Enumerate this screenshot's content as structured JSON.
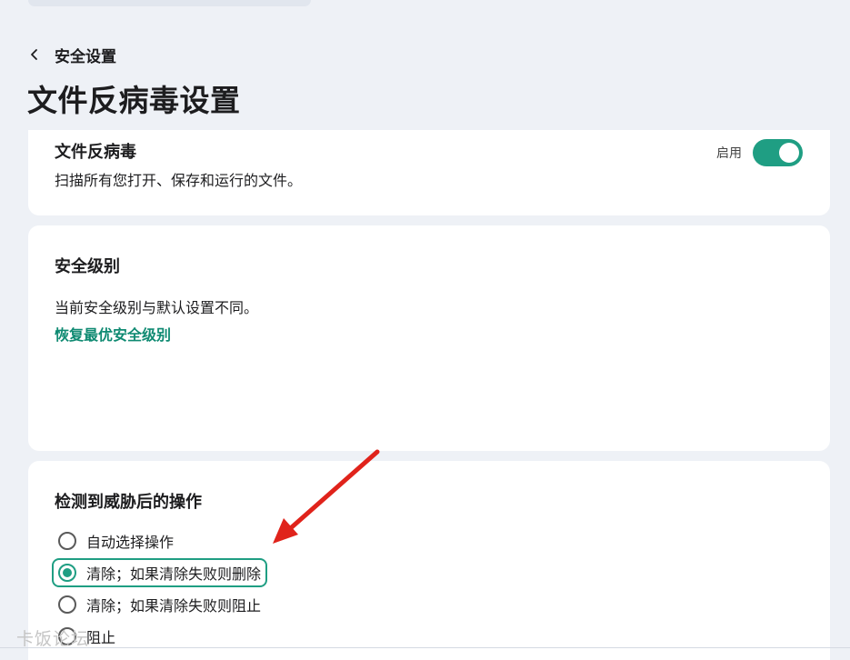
{
  "breadcrumb": {
    "back_label": "安全设置"
  },
  "page_title": "文件反病毒设置",
  "file_antivirus": {
    "title": "文件反病毒",
    "description": "扫描所有您打开、保存和运行的文件。",
    "toggle_label": "启用",
    "toggle_state": "on"
  },
  "security_level": {
    "title": "安全级别",
    "status_text": "当前安全级别与默认设置不同。",
    "restore_link": "恢复最优安全级别"
  },
  "threat_actions": {
    "title": "检测到威胁后的操作",
    "options": [
      {
        "label": "自动选择操作",
        "selected": false
      },
      {
        "label": "清除；如果清除失败则删除",
        "selected": true
      },
      {
        "label": "清除；如果清除失败则阻止",
        "selected": false
      },
      {
        "label": "阻止",
        "selected": false
      }
    ]
  },
  "watermark": "卡饭论坛",
  "colors": {
    "accent": "#1f9e83",
    "link": "#0f8a72",
    "annotation_arrow": "#e0231b"
  }
}
